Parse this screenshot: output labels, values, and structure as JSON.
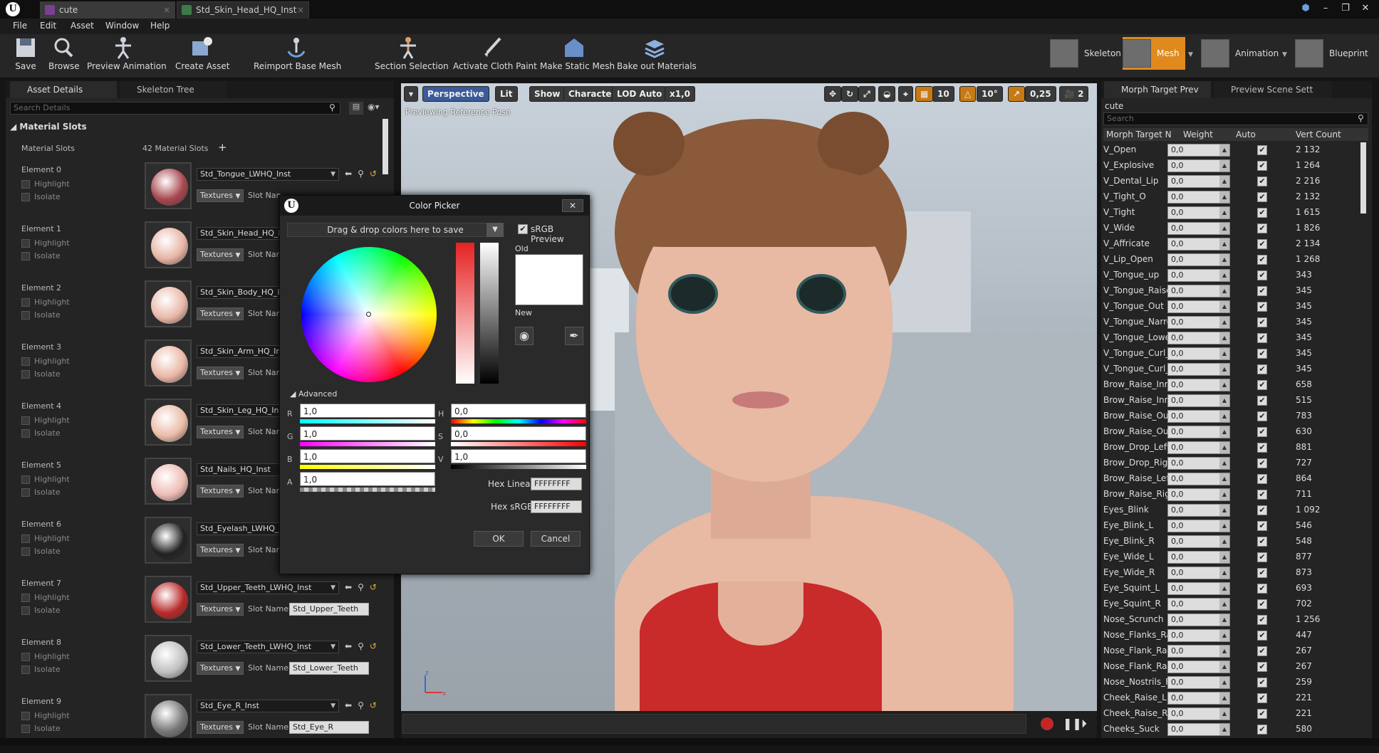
{
  "tabs": [
    {
      "label": "cute"
    },
    {
      "label": "Std_Skin_Head_HQ_Inst"
    }
  ],
  "menu": [
    "File",
    "Edit",
    "Asset",
    "Window",
    "Help"
  ],
  "toolbar": {
    "buttons": [
      "Save",
      "Browse",
      "Preview Animation",
      "Create Asset",
      "Reimport Base Mesh",
      "Section Selection",
      "Activate Cloth Paint",
      "Make Static Mesh",
      "Bake out Materials"
    ],
    "modes": [
      "Skeleton",
      "Mesh",
      "Animation",
      "Blueprint"
    ]
  },
  "left_panel": {
    "tabs": [
      "Asset Details",
      "Skeleton Tree"
    ],
    "search_placeholder": "Search Details",
    "section": "Material Slots",
    "slots_label": "Material Slots",
    "slots_count": "42 Material Slots",
    "highlight_label": "Highlight",
    "isolate_label": "Isolate",
    "textures_label": "Textures",
    "slot_name_label": "Slot Name",
    "slot_name_short": "Slot Nan",
    "elements": [
      {
        "name": "Element 0",
        "material": "Std_Tongue_LWHQ_Inst",
        "slot": "",
        "color": "#a8474f"
      },
      {
        "name": "Element 1",
        "material": "Std_Skin_Head_HQ_In",
        "slot": "",
        "color": "#e8b5a5"
      },
      {
        "name": "Element 2",
        "material": "Std_Skin_Body_HQ_Ins",
        "slot": "",
        "color": "#eab9a8"
      },
      {
        "name": "Element 3",
        "material": "Std_Skin_Arm_HQ_Ins",
        "slot": "",
        "color": "#eab7a5"
      },
      {
        "name": "Element 4",
        "material": "Std_Skin_Leg_HQ_Inst",
        "slot": "",
        "color": "#ebbca9"
      },
      {
        "name": "Element 5",
        "material": "Std_Nails_HQ_Inst",
        "slot": "",
        "color": "#eebdb5"
      },
      {
        "name": "Element 6",
        "material": "Std_Eyelash_LWHQ_In",
        "slot": "",
        "color": "#222222"
      },
      {
        "name": "Element 7",
        "material": "Std_Upper_Teeth_LWHQ_Inst",
        "slot": "Std_Upper_Teeth",
        "color": "#b82a2a"
      },
      {
        "name": "Element 8",
        "material": "Std_Lower_Teeth_LWHQ_Inst",
        "slot": "Std_Lower_Teeth",
        "color": "#c0c0c0"
      },
      {
        "name": "Element 9",
        "material": "Std_Eye_R_Inst",
        "slot": "Std_Eye_R",
        "color": "#777777"
      }
    ]
  },
  "viewport": {
    "buttons": [
      "Perspective",
      "Lit",
      "Show",
      "Character",
      "LOD Auto",
      "x1,0"
    ],
    "right_values": [
      "10",
      "10°",
      "0,25",
      "2"
    ],
    "overlay_text": "Previewing Reference Pose"
  },
  "color_picker": {
    "title": "Color Picker",
    "drop_text": "Drag & drop colors here to save",
    "srgb_label": "sRGB Preview",
    "old_label": "Old",
    "new_label": "New",
    "advanced_label": "Advanced",
    "r": "1,0",
    "g": "1,0",
    "b": "1,0",
    "a": "1,0",
    "h": "0,0",
    "s": "0,0",
    "v": "1,0",
    "hex_linear_label": "Hex Linear",
    "hex_linear": "FFFFFFFF",
    "hex_srgb_label": "Hex sRGB",
    "hex_srgb": "FFFFFFFF",
    "ok": "OK",
    "cancel": "Cancel"
  },
  "right_panel": {
    "tabs": [
      "Morph Target Prev",
      "Preview Scene Sett"
    ],
    "asset_name": "cute",
    "search_placeholder": "Search",
    "columns": [
      "Morph Target N",
      "Weight",
      "Auto",
      "Vert Count"
    ],
    "weight_default": "0,0",
    "rows": [
      {
        "name": "V_Open",
        "count": "2 132"
      },
      {
        "name": "V_Explosive",
        "count": "1 264"
      },
      {
        "name": "V_Dental_Lip",
        "count": "2 216"
      },
      {
        "name": "V_Tight_O",
        "count": "2 132"
      },
      {
        "name": "V_Tight",
        "count": "1 615"
      },
      {
        "name": "V_Wide",
        "count": "1 826"
      },
      {
        "name": "V_Affricate",
        "count": "2 134"
      },
      {
        "name": "V_Lip_Open",
        "count": "1 268"
      },
      {
        "name": "V_Tongue_up",
        "count": "343"
      },
      {
        "name": "V_Tongue_Raise",
        "count": "345"
      },
      {
        "name": "V_Tongue_Out",
        "count": "345"
      },
      {
        "name": "V_Tongue_Narro",
        "count": "345"
      },
      {
        "name": "V_Tongue_Lowe",
        "count": "345"
      },
      {
        "name": "V_Tongue_Curl_",
        "count": "345"
      },
      {
        "name": "V_Tongue_Curl_",
        "count": "345"
      },
      {
        "name": "Brow_Raise_Inne",
        "count": "658"
      },
      {
        "name": "Brow_Raise_Inne",
        "count": "515"
      },
      {
        "name": "Brow_Raise_Out",
        "count": "783"
      },
      {
        "name": "Brow_Raise_Out",
        "count": "630"
      },
      {
        "name": "Brow_Drop_Left",
        "count": "881"
      },
      {
        "name": "Brow_Drop_Righ",
        "count": "727"
      },
      {
        "name": "Brow_Raise_Left",
        "count": "864"
      },
      {
        "name": "Brow_Raise_Rigi",
        "count": "711"
      },
      {
        "name": "Eyes_Blink",
        "count": "1 092"
      },
      {
        "name": "Eye_Blink_L",
        "count": "546"
      },
      {
        "name": "Eye_Blink_R",
        "count": "548"
      },
      {
        "name": "Eye_Wide_L",
        "count": "877"
      },
      {
        "name": "Eye_Wide_R",
        "count": "873"
      },
      {
        "name": "Eye_Squint_L",
        "count": "693"
      },
      {
        "name": "Eye_Squint_R",
        "count": "702"
      },
      {
        "name": "Nose_Scrunch",
        "count": "1 256"
      },
      {
        "name": "Nose_Flanks_Ra",
        "count": "447"
      },
      {
        "name": "Nose_Flank_Rais",
        "count": "267"
      },
      {
        "name": "Nose_Flank_Rais",
        "count": "267"
      },
      {
        "name": "Nose_Nostrils_Fl",
        "count": "259"
      },
      {
        "name": "Cheek_Raise_L",
        "count": "221"
      },
      {
        "name": "Cheek_Raise_R",
        "count": "221"
      },
      {
        "name": "Cheeks_Suck",
        "count": "580"
      }
    ]
  }
}
